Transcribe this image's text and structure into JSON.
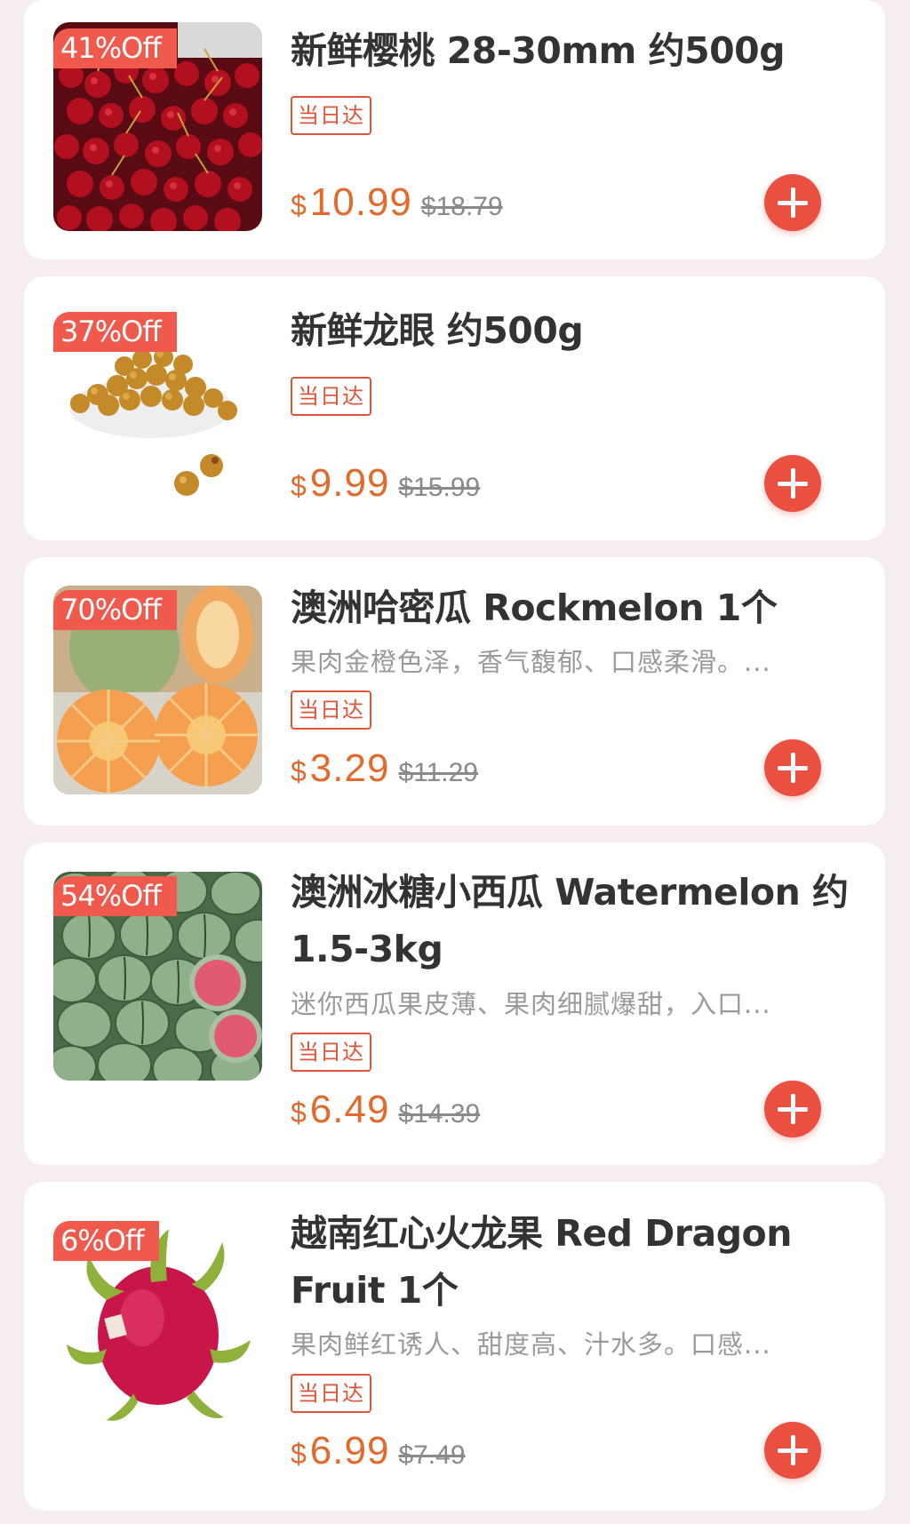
{
  "products": [
    {
      "title": "新鲜樱桃 28-30mm 约500g",
      "description": "",
      "discount": "41%Off",
      "tag": "当日达",
      "currency": "$",
      "price": "10.99",
      "original_price": "$18.79",
      "image": "cherries-image"
    },
    {
      "title": "新鲜龙眼 约500g",
      "description": "",
      "discount": "37%Off",
      "tag": "当日达",
      "currency": "$",
      "price": "9.99",
      "original_price": "$15.99",
      "image": "longan-image"
    },
    {
      "title": "澳洲哈密瓜 Rockmelon 1个",
      "description": "果肉金橙色泽，香气馥郁、口感柔滑。...",
      "discount": "70%Off",
      "tag": "当日达",
      "currency": "$",
      "price": "3.29",
      "original_price": "$11.29",
      "image": "rockmelon-image"
    },
    {
      "title": "澳洲冰糖小西瓜 Watermelon 约1.5-3kg",
      "description": "迷你西瓜果皮薄、果肉细腻爆甜，入口...",
      "discount": "54%Off",
      "tag": "当日达",
      "currency": "$",
      "price": "6.49",
      "original_price": "$14.39",
      "image": "watermelon-image"
    },
    {
      "title": "越南红心火龙果 Red Dragon Fruit 1个",
      "description": "果肉鲜红诱人、甜度高、汁水多。口感...",
      "discount": "6%Off",
      "tag": "当日达",
      "currency": "$",
      "price": "6.99",
      "original_price": "$7.49",
      "image": "dragon-fruit-image"
    }
  ],
  "colors": {
    "accent": "#ea5040",
    "price": "#e26a2c",
    "background": "#f6eeee",
    "card": "#ffffff"
  }
}
